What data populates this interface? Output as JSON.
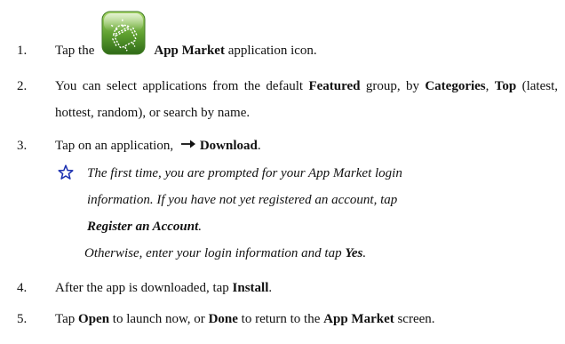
{
  "steps": [
    {
      "number": "1.",
      "before": "Tap the",
      "bold": "App Market",
      "after": " application icon.",
      "icon": "app-market-android-icon"
    },
    {
      "number": "2.",
      "t1": "You can select applications from the default ",
      "b1": "Featured",
      "t2": " group, by ",
      "b2": "Categories",
      "t3": ", ",
      "b3": "Top",
      "t4": " (latest, hottest, random), or search by name."
    },
    {
      "number": "3.",
      "text": "Tap on an application, ",
      "arrow_icon": "right-arrow-icon",
      "bold": "Download",
      "end": "."
    },
    {
      "number": "4.",
      "text": "After the app is downloaded, tap ",
      "bold": "Install",
      "end": "."
    },
    {
      "number": "5.",
      "t1": "Tap ",
      "b1": "Open",
      "t2": " to launch now, or ",
      "b2": "Done",
      "t3": " to return to the ",
      "b3": "App Market",
      "t4": " screen."
    }
  ],
  "note": {
    "icon": "star-outline-icon",
    "line1": "The first time, you are prompted for your App Market login",
    "line2": "information. If you have not yet registered an account, tap",
    "bold": "Register an Account",
    "end": "."
  },
  "otherwise": {
    "text": "Otherwise, enter your login information and tap ",
    "bold": "Yes",
    "end": "."
  },
  "colors": {
    "text": "#111111",
    "star": "#1a2fb0",
    "icon_green": "#5c9e2e"
  }
}
